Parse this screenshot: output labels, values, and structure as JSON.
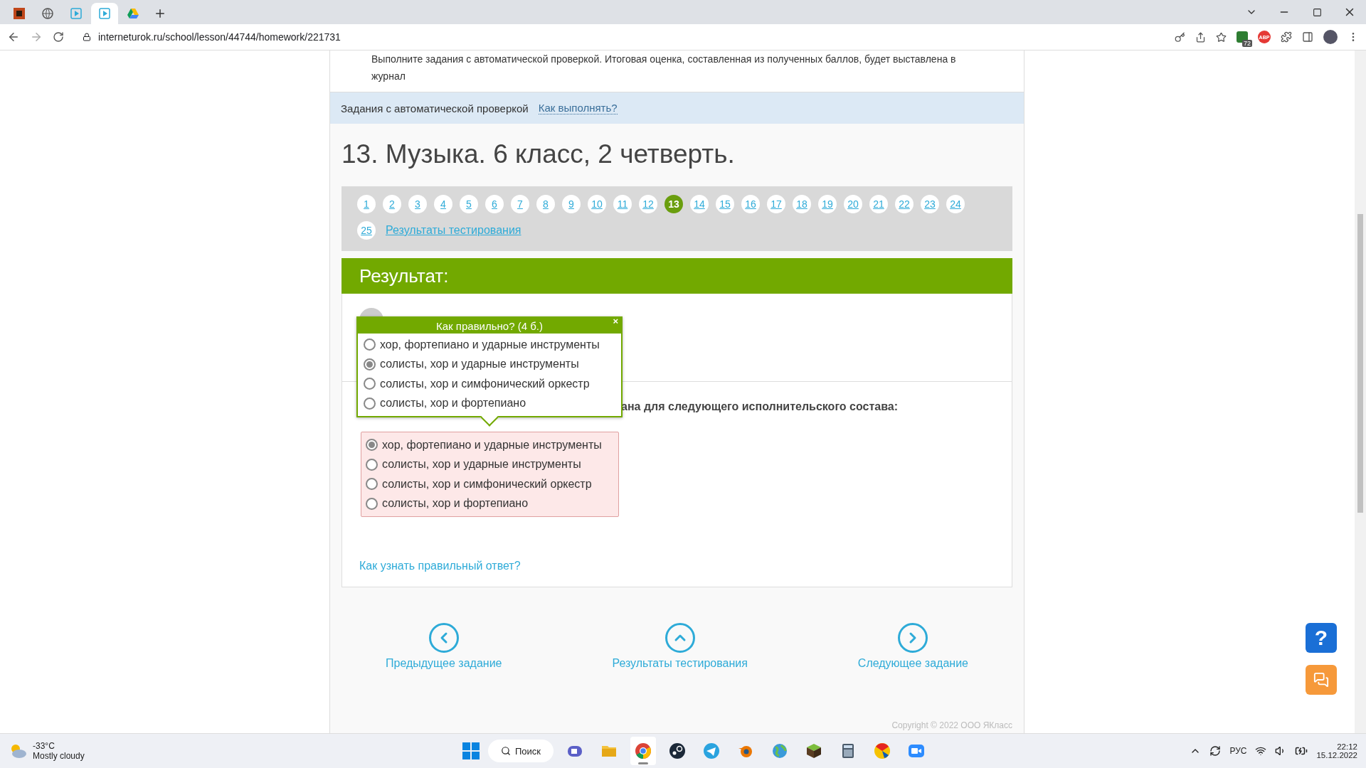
{
  "browser": {
    "tabs": [
      {
        "kind": "block",
        "selected": false
      },
      {
        "kind": "globe",
        "selected": false
      },
      {
        "kind": "play",
        "selected": false
      },
      {
        "kind": "play",
        "selected": true
      },
      {
        "kind": "drive",
        "selected": false
      }
    ],
    "url": "interneturok.ru/school/lesson/44744/homework/221731",
    "extension_badge": "72",
    "adblock": "ABP"
  },
  "page": {
    "intro": "Выполните задания с автоматической проверкой. Итоговая оценка, составленная из полученных баллов, будет выставлена в журнал",
    "auto_bar": {
      "label": "Задания с автоматической проверкой",
      "link": "Как выполнять?"
    },
    "title": "13. Музыка. 6 класс, 2 четверть.",
    "pagination": {
      "pages": [
        {
          "label": "1",
          "selected": false
        },
        {
          "label": "2",
          "selected": false
        },
        {
          "label": "3",
          "selected": false
        },
        {
          "label": "4",
          "selected": false
        },
        {
          "label": "5",
          "selected": false
        },
        {
          "label": "6",
          "selected": false
        },
        {
          "label": "7",
          "selected": false
        },
        {
          "label": "8",
          "selected": false
        },
        {
          "label": "9",
          "selected": false
        },
        {
          "label": "10",
          "selected": false
        },
        {
          "label": "11",
          "selected": false
        },
        {
          "label": "12",
          "selected": false
        },
        {
          "label": "13",
          "selected": true
        },
        {
          "label": "14",
          "selected": false
        },
        {
          "label": "15",
          "selected": false
        },
        {
          "label": "16",
          "selected": false
        },
        {
          "label": "17",
          "selected": false
        },
        {
          "label": "18",
          "selected": false
        },
        {
          "label": "19",
          "selected": false
        },
        {
          "label": "20",
          "selected": false
        },
        {
          "label": "21",
          "selected": false
        },
        {
          "label": "22",
          "selected": false
        },
        {
          "label": "23",
          "selected": false
        },
        {
          "label": "24",
          "selected": false
        },
        {
          "label": "25",
          "selected": false
        }
      ],
      "results_link": "Результаты тестирования"
    },
    "result": {
      "heading": "Результат:",
      "popup": {
        "title": "Как правильно? (4 б.)",
        "close": "×",
        "options": [
          {
            "label": "хор, фортепиано и ударные инструменты",
            "selected": false
          },
          {
            "label": "солисты, хор и ударные инструменты",
            "selected": true
          },
          {
            "label": "солисты, хор и симфонический оркестр",
            "selected": false
          },
          {
            "label": "солисты, хор и фортепиано",
            "selected": false
          }
        ]
      },
      "question_fragment": "ана для следующего исполнительского состава:",
      "answer": {
        "correct": false,
        "options": [
          {
            "label": "хор, фортепиано и ударные инструменты",
            "selected": true
          },
          {
            "label": "солисты, хор и ударные инструменты",
            "selected": false
          },
          {
            "label": "солисты, хор и симфонический оркестр",
            "selected": false
          },
          {
            "label": "солисты, хор и фортепиано",
            "selected": false
          }
        ]
      },
      "help_link": "Как узнать правильный ответ?"
    },
    "nav": [
      {
        "kind": "prev",
        "label": "Предыдущее задание"
      },
      {
        "kind": "up",
        "label": "Результаты тестирования"
      },
      {
        "kind": "next",
        "label": "Следующее задание"
      }
    ],
    "copyright": "Copyright © 2022 ООО ЯКласс",
    "help_button": "?"
  },
  "taskbar": {
    "temperature": "-33°C",
    "weather": "Mostly cloudy",
    "search": "Поиск",
    "apps": [
      {
        "kind": "video-call",
        "selected": false
      },
      {
        "kind": "folder",
        "selected": false
      },
      {
        "kind": "chrome",
        "selected": true
      },
      {
        "kind": "steam",
        "selected": false
      },
      {
        "kind": "telegram",
        "selected": false
      },
      {
        "kind": "blender",
        "selected": false
      },
      {
        "kind": "globe",
        "selected": false
      },
      {
        "kind": "cube",
        "selected": false
      },
      {
        "kind": "calculator",
        "selected": false
      },
      {
        "kind": "ball",
        "selected": false
      },
      {
        "kind": "camera",
        "selected": false
      }
    ],
    "language": "РУС",
    "time": "22:12",
    "date": "15.12.2022"
  }
}
